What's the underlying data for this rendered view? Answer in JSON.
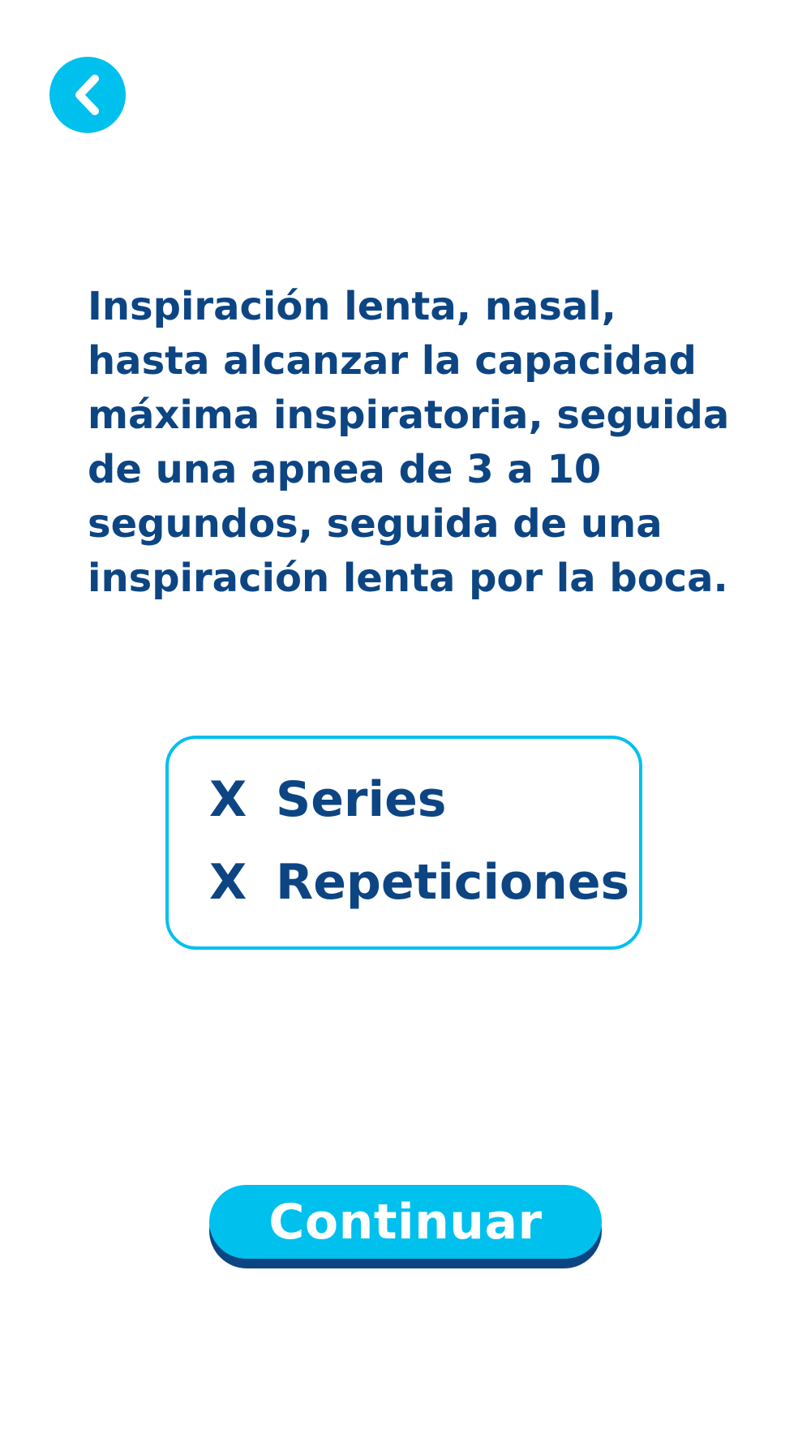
{
  "header": {
    "back_icon": "chevron-left-icon"
  },
  "exercise": {
    "description": "Inspiración lenta, nasal, hasta alcanzar la capacidad máxima inspiratoria, seguida de una apnea de 3 a 10 segundos, seguida de una inspiración lenta por la boca."
  },
  "prescription": {
    "series_value": "X",
    "series_label": "Series",
    "repetitions_value": "X",
    "repetitions_label": "Repeticiones"
  },
  "footer": {
    "continue_label": "Continuar"
  },
  "colors": {
    "accent": "#00c0ee",
    "text": "#0d4583",
    "button_shadow": "#0d4583",
    "background": "#ffffff"
  }
}
